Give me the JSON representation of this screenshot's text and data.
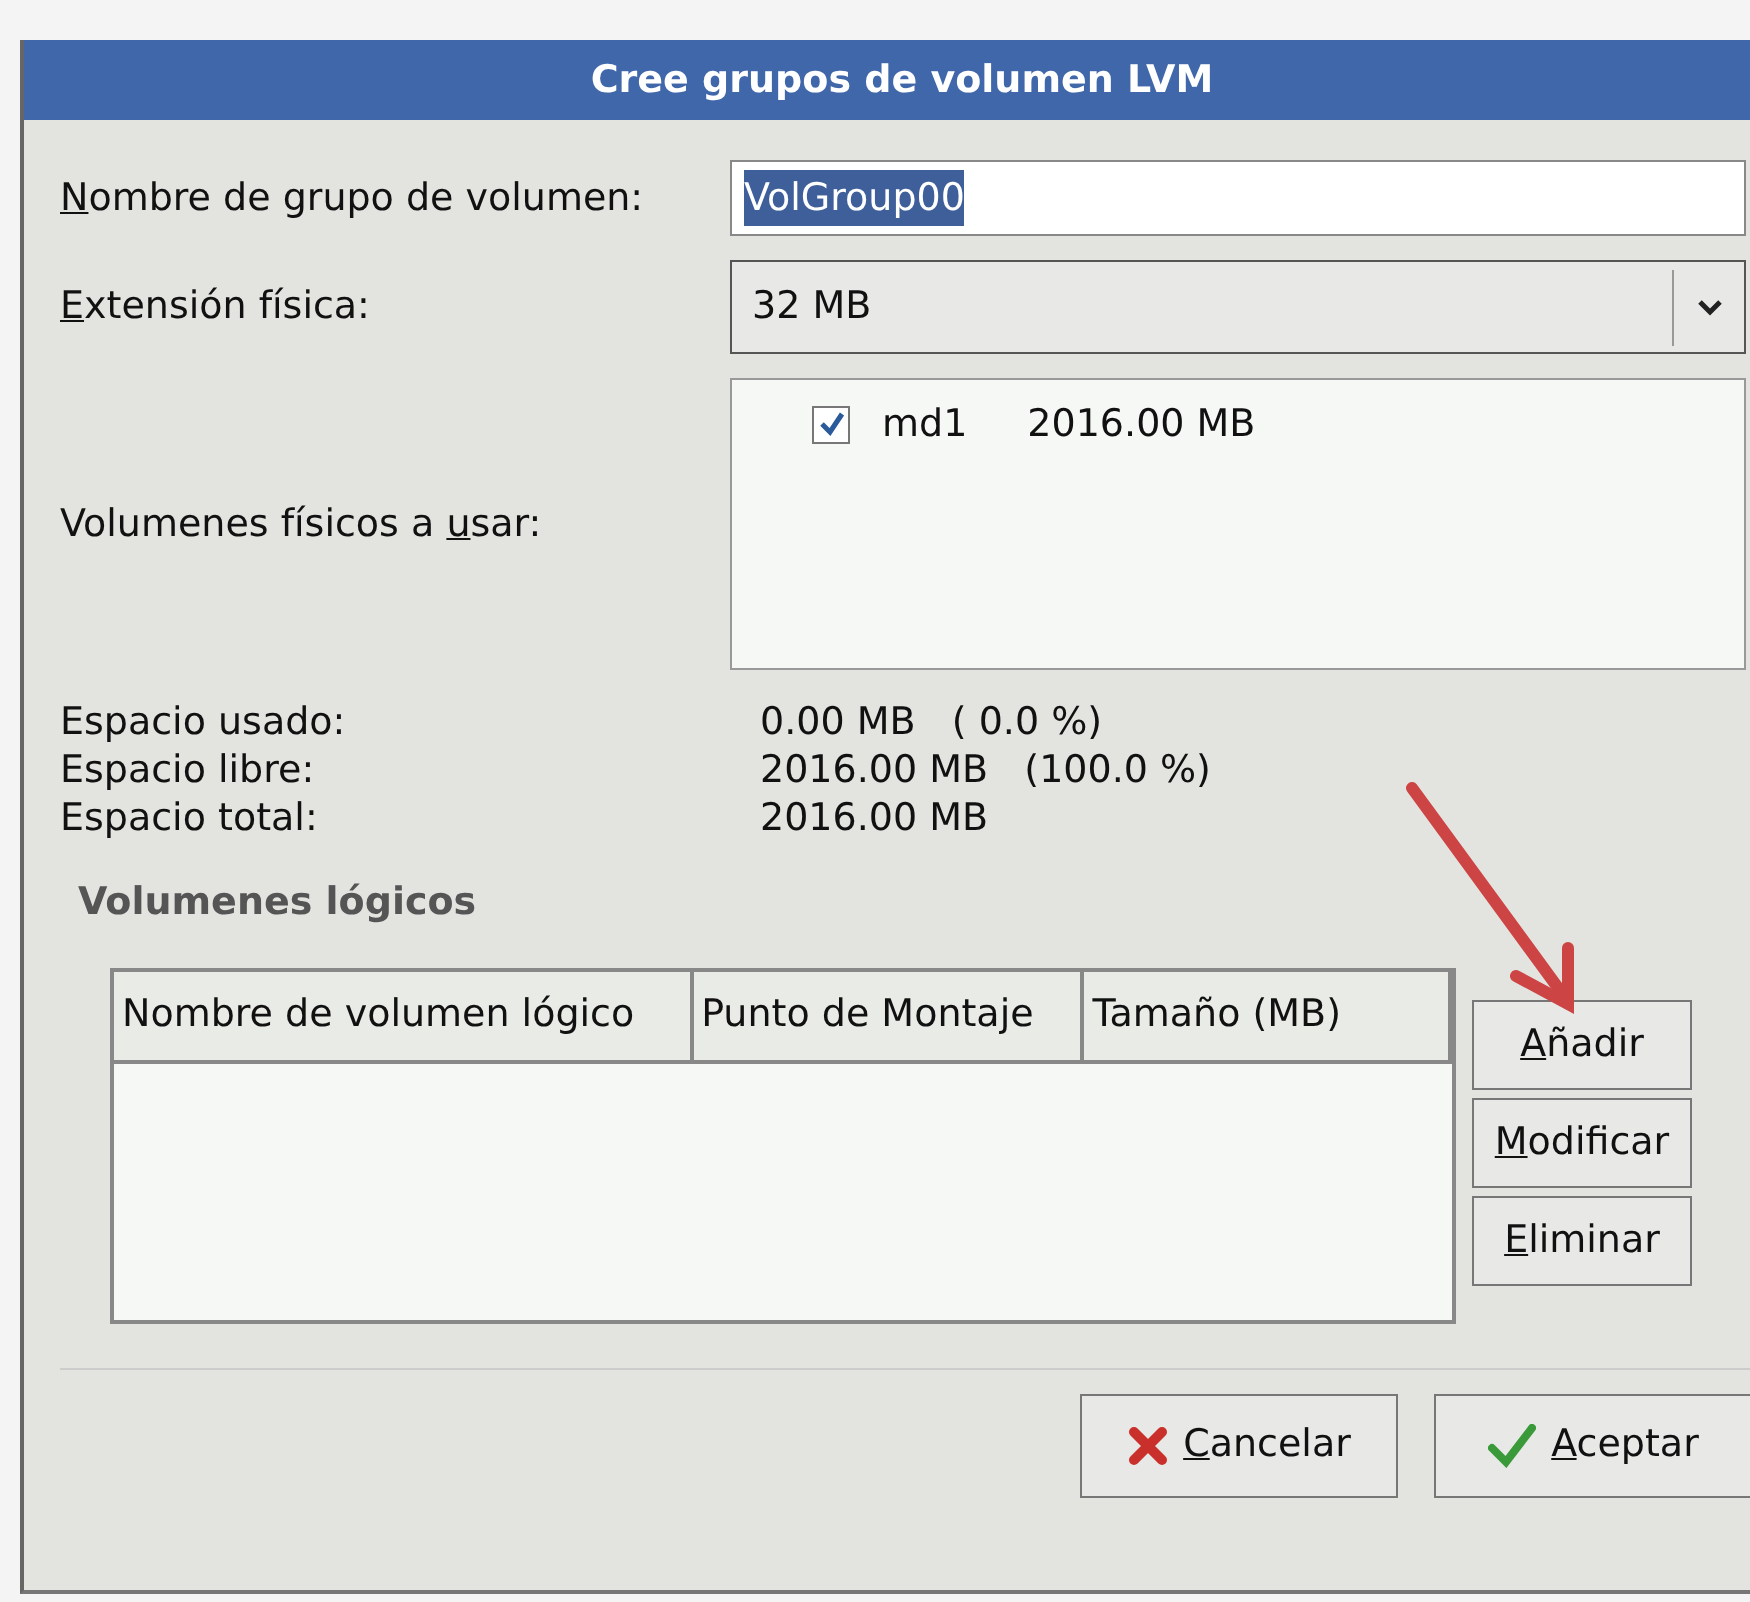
{
  "window": {
    "title": "Cree grupos de volumen LVM"
  },
  "fields": [
    {
      "kind": "text",
      "label": {
        "key": "N",
        "after": "ombre de grupo de volumen:"
      },
      "value": "VolGroup00",
      "selected": true
    },
    {
      "kind": "combo",
      "label": {
        "key": "E",
        "after": "xtensión física:"
      },
      "value": "32 MB"
    }
  ],
  "physical_volumes": {
    "label": {
      "before": "Volumenes físicos a ",
      "key": "u",
      "after": "sar:"
    },
    "items": [
      {
        "name": "md1",
        "size": "2016.00 MB",
        "checked": true
      }
    ]
  },
  "space": [
    {
      "label": "Espacio usado:",
      "value": "0.00 MB   ( 0.0 %)"
    },
    {
      "label": "Espacio libre:",
      "value": "2016.00 MB   (100.0 %)"
    },
    {
      "label": "Espacio total:",
      "value": "2016.00 MB"
    }
  ],
  "logical_volumes": {
    "title": "Volumenes lógicos",
    "columns": [
      "Nombre de volumen lógico",
      "Punto de Montaje",
      "Tamaño (MB)"
    ],
    "buttons": [
      {
        "label": {
          "key": "A",
          "after": "ñadir"
        }
      },
      {
        "label": {
          "key": "M",
          "after": "odificar"
        }
      },
      {
        "label": {
          "key": "E",
          "after": "liminar"
        }
      }
    ]
  },
  "buttons": [
    {
      "kind": "cancel",
      "label": {
        "key": "C",
        "after": "ancelar"
      }
    },
    {
      "kind": "ok",
      "label": {
        "key": "A",
        "after": "ceptar"
      }
    }
  ]
}
